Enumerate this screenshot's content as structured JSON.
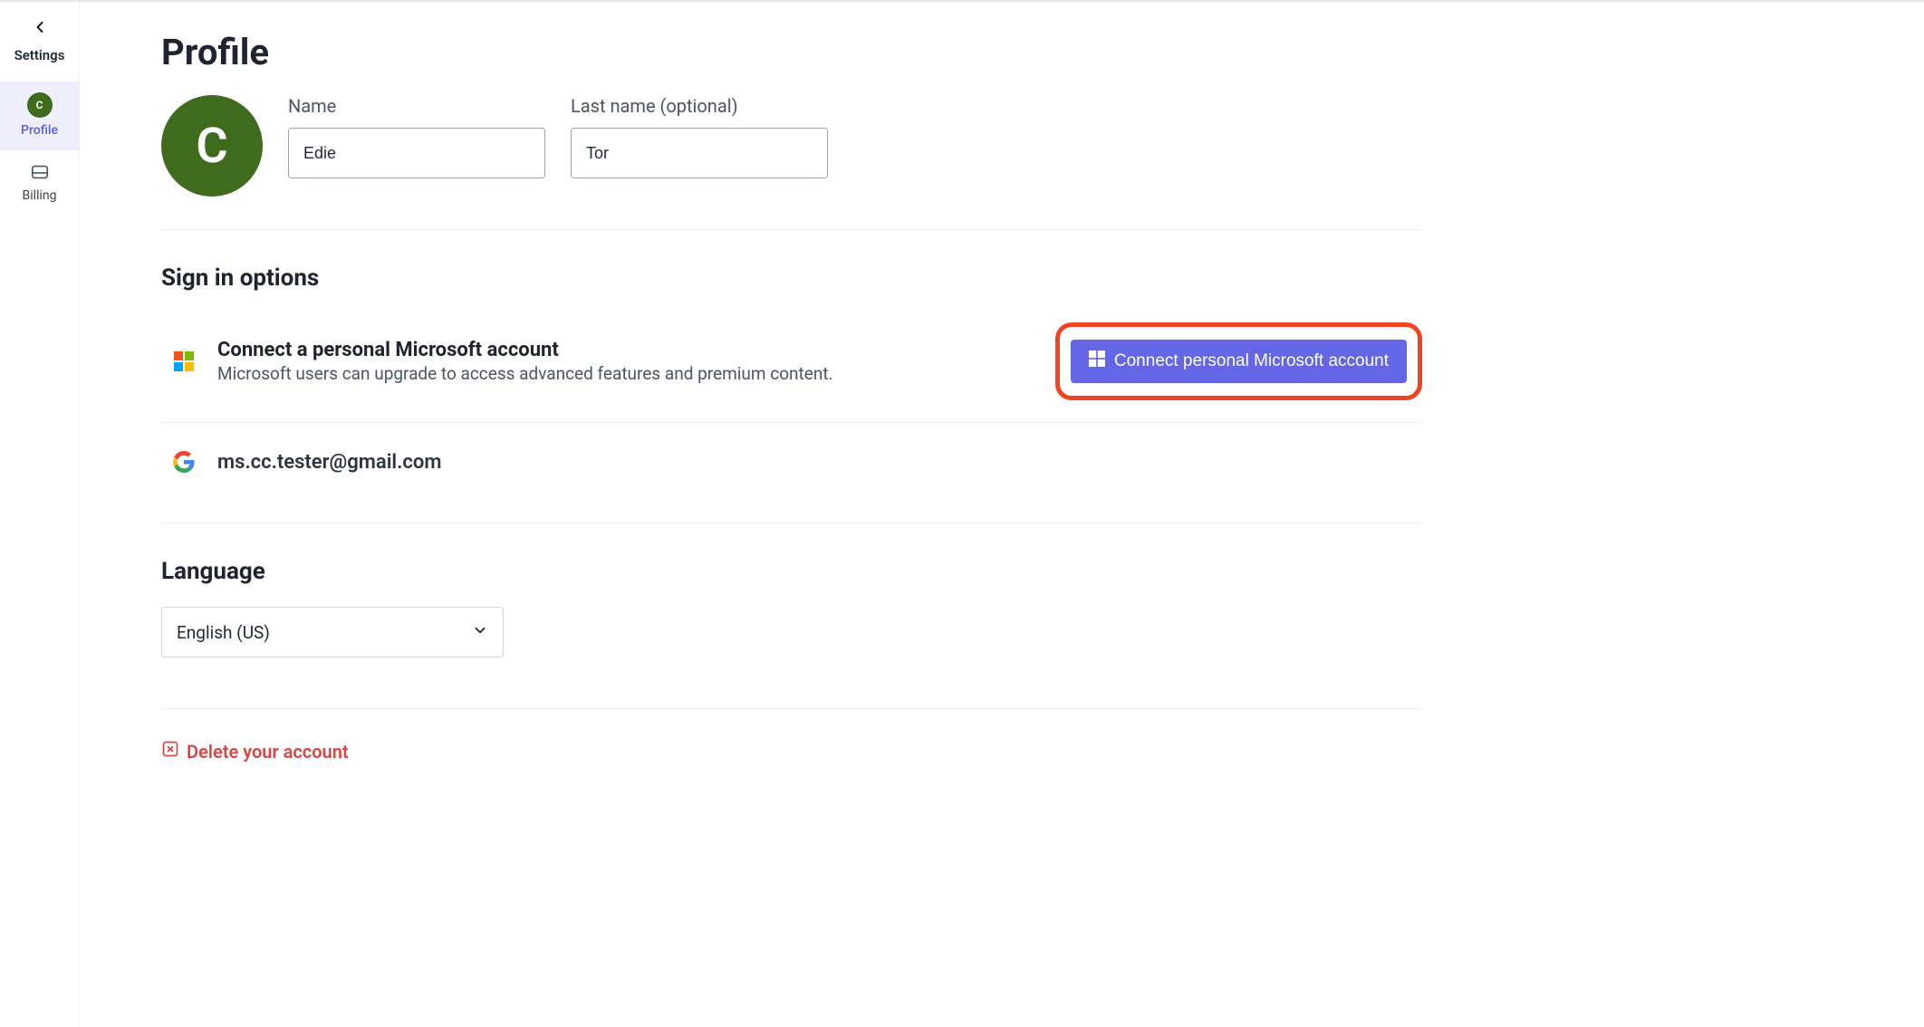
{
  "sidebar": {
    "back_label": "Settings",
    "items": [
      {
        "label": "Profile",
        "avatar_initial": "C"
      },
      {
        "label": "Billing"
      }
    ]
  },
  "page": {
    "title": "Profile"
  },
  "avatar": {
    "initial": "C"
  },
  "fields": {
    "first_name_label": "Name",
    "first_name_value": "Edie",
    "last_name_label": "Last name (optional)",
    "last_name_value": "Tor"
  },
  "signin": {
    "section_title": "Sign in options",
    "microsoft": {
      "title": "Connect a personal Microsoft account",
      "subtitle": "Microsoft users can upgrade to access advanced features and premium content.",
      "button_label": "Connect personal Microsoft account"
    },
    "google": {
      "email": "ms.cc.tester@gmail.com"
    }
  },
  "language": {
    "section_title": "Language",
    "selected": "English (US)"
  },
  "delete": {
    "label": "Delete your account"
  }
}
